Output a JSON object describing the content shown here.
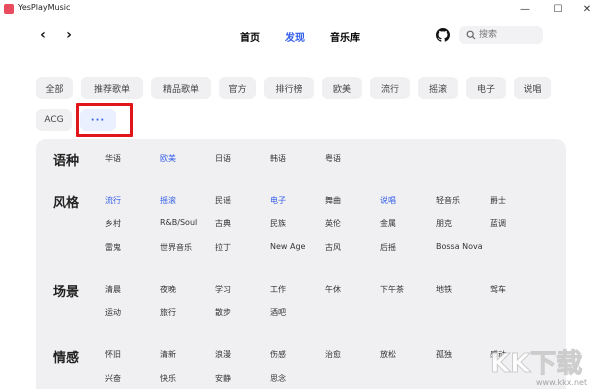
{
  "window": {
    "title": "YesPlayMusic",
    "minimize": "—",
    "maximize": "☐",
    "close": "✕"
  },
  "nav": {
    "back": "‹",
    "forward": "›",
    "tabs": [
      {
        "label": "首页",
        "active": false
      },
      {
        "label": "发现",
        "active": true
      },
      {
        "label": "音乐库",
        "active": false
      }
    ],
    "search_placeholder": "搜索"
  },
  "categories": {
    "row1": [
      "全部",
      "推荐歌单",
      "精品歌单",
      "官方",
      "排行榜",
      "欧美",
      "流行",
      "摇滚",
      "电子",
      "说唱"
    ],
    "row2": [
      "ACG",
      "···"
    ]
  },
  "panel": {
    "sections": [
      {
        "title": "语种",
        "tags": [
          {
            "label": "华语",
            "active": false
          },
          {
            "label": "欧美",
            "active": true
          },
          {
            "label": "日语",
            "active": false
          },
          {
            "label": "韩语",
            "active": false
          },
          {
            "label": "粤语",
            "active": false
          }
        ]
      },
      {
        "title": "风格",
        "tags": [
          {
            "label": "流行",
            "active": true
          },
          {
            "label": "摇滚",
            "active": true
          },
          {
            "label": "民谣",
            "active": false
          },
          {
            "label": "电子",
            "active": true
          },
          {
            "label": "舞曲",
            "active": false
          },
          {
            "label": "说唱",
            "active": true
          },
          {
            "label": "轻音乐",
            "active": false
          },
          {
            "label": "爵士",
            "active": false
          },
          {
            "label": "乡村",
            "active": false
          },
          {
            "label": "R&B/Soul",
            "active": false
          },
          {
            "label": "古典",
            "active": false
          },
          {
            "label": "民族",
            "active": false
          },
          {
            "label": "英伦",
            "active": false
          },
          {
            "label": "金属",
            "active": false
          },
          {
            "label": "朋克",
            "active": false
          },
          {
            "label": "蓝调",
            "active": false
          },
          {
            "label": "雷鬼",
            "active": false
          },
          {
            "label": "世界音乐",
            "active": false
          },
          {
            "label": "拉丁",
            "active": false
          },
          {
            "label": "New Age",
            "active": false
          },
          {
            "label": "古风",
            "active": false
          },
          {
            "label": "后摇",
            "active": false
          },
          {
            "label": "Bossa Nova",
            "active": false
          }
        ]
      },
      {
        "title": "场景",
        "tags": [
          {
            "label": "清晨",
            "active": false
          },
          {
            "label": "夜晚",
            "active": false
          },
          {
            "label": "学习",
            "active": false
          },
          {
            "label": "工作",
            "active": false
          },
          {
            "label": "午休",
            "active": false
          },
          {
            "label": "下午茶",
            "active": false
          },
          {
            "label": "地铁",
            "active": false
          },
          {
            "label": "驾车",
            "active": false
          },
          {
            "label": "运动",
            "active": false
          },
          {
            "label": "旅行",
            "active": false
          },
          {
            "label": "散步",
            "active": false
          },
          {
            "label": "酒吧",
            "active": false
          }
        ]
      },
      {
        "title": "情感",
        "tags": [
          {
            "label": "怀旧",
            "active": false
          },
          {
            "label": "清新",
            "active": false
          },
          {
            "label": "浪漫",
            "active": false
          },
          {
            "label": "伤感",
            "active": false
          },
          {
            "label": "治愈",
            "active": false
          },
          {
            "label": "放松",
            "active": false
          },
          {
            "label": "孤独",
            "active": false
          },
          {
            "label": "感动",
            "active": false
          },
          {
            "label": "兴奋",
            "active": false
          },
          {
            "label": "快乐",
            "active": false
          },
          {
            "label": "安静",
            "active": false
          },
          {
            "label": "思念",
            "active": false
          }
        ]
      }
    ]
  },
  "watermark": {
    "big": "KK下载",
    "url": "www.kkx.net"
  },
  "colors": {
    "accent": "#335eea",
    "highlight": "#e0161b"
  }
}
